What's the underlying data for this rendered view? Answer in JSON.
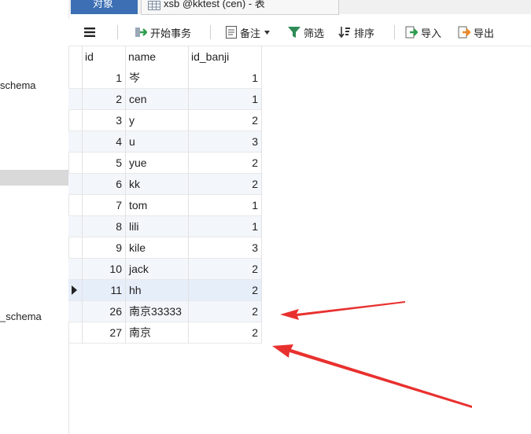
{
  "tabs": {
    "objects_label": "对象",
    "table_tab_label": "xsb @kktest (cen) - 表"
  },
  "sidebar": {
    "items": [
      {
        "label": "schema"
      },
      {
        "label": "_schema"
      }
    ]
  },
  "toolbar": {
    "begin_tx": "开始事务",
    "note": "备注",
    "filter": "筛选",
    "sort": "排序",
    "import": "导入",
    "export": "导出"
  },
  "table": {
    "columns": [
      "id",
      "name",
      "id_banji"
    ],
    "rows": [
      {
        "id": "1",
        "name": "岑",
        "id_banji": "1"
      },
      {
        "id": "2",
        "name": "cen",
        "id_banji": "1"
      },
      {
        "id": "3",
        "name": "y",
        "id_banji": "2"
      },
      {
        "id": "4",
        "name": "u",
        "id_banji": "3"
      },
      {
        "id": "5",
        "name": "yue",
        "id_banji": "2"
      },
      {
        "id": "6",
        "name": "kk",
        "id_banji": "2"
      },
      {
        "id": "7",
        "name": "tom",
        "id_banji": "1"
      },
      {
        "id": "8",
        "name": "lili",
        "id_banji": "1"
      },
      {
        "id": "9",
        "name": "kile",
        "id_banji": "3"
      },
      {
        "id": "10",
        "name": "jack",
        "id_banji": "2"
      },
      {
        "id": "11",
        "name": "hh",
        "id_banji": "2"
      },
      {
        "id": "26",
        "name": "南京33333",
        "id_banji": "2"
      },
      {
        "id": "27",
        "name": "南京",
        "id_banji": "2"
      }
    ]
  },
  "colors": {
    "accent_tab": "#3c6fb4",
    "annotation_arrow": "#e8312f",
    "filter_icon": "#2e8b57"
  }
}
